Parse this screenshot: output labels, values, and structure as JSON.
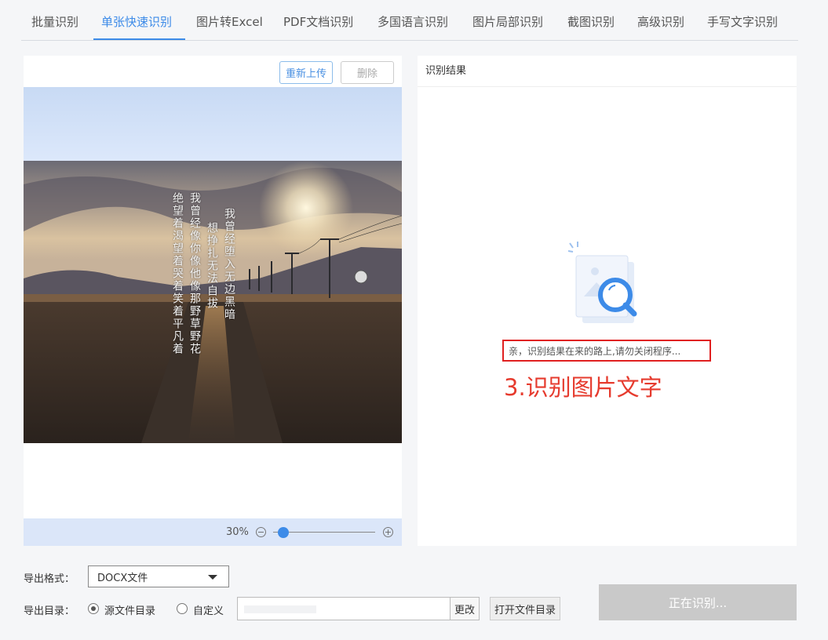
{
  "tabs": [
    {
      "label": "批量识别"
    },
    {
      "label": "单张快速识别",
      "active": true
    },
    {
      "label": "图片转Excel"
    },
    {
      "label": "PDF文档识别"
    },
    {
      "label": "多国语言识别"
    },
    {
      "label": "图片局部识别"
    },
    {
      "label": "截图识别"
    },
    {
      "label": "高级识别"
    },
    {
      "label": "手写文字识别"
    }
  ],
  "preview": {
    "reupload_label": "重新上传",
    "delete_label": "删除",
    "poem_columns": [
      "我曾经堕入无边黑暗",
      "想挣扎无法自拔",
      "我曾经像你像他像那野草野花",
      "绝望着渴望着哭着笑着平凡着"
    ],
    "zoom": "30%",
    "zoom_level": 0.1,
    "zoom_minus_icon": "zoom-out-icon",
    "zoom_plus_icon": "zoom-in-icon"
  },
  "result": {
    "header": "识别结果",
    "waiting_text": "亲，识别结果在来的路上,请勿关闭程序...",
    "annotation": "3.识别图片文字",
    "annotation_color": "#e63b2e",
    "illustration_icon": "magnifier-document-icon"
  },
  "export": {
    "format_label": "导出格式：",
    "format_value": "DOCX文件",
    "dir_label": "导出目录：",
    "option_source": "源文件目录",
    "option_custom": "自定义",
    "change_label": "更改",
    "open_dir_label": "打开文件目录",
    "main_button_label": "正在识别..."
  },
  "colors": {
    "accent": "#3d8be8",
    "disabled_button": "#c9c9c9",
    "highlight_border": "#e02020"
  }
}
